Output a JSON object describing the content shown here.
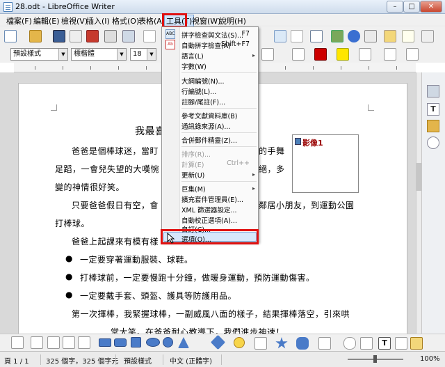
{
  "window": {
    "title": "28.odt - LibreOffice Writer",
    "min": "–",
    "max": "□",
    "close": "✕"
  },
  "menubar": {
    "items": [
      "檔案(F)",
      "編輯(E)",
      "檢視(V)",
      "插入(I)",
      "格式(O)",
      "表格(A)",
      "工具(T)",
      "視窗(W)",
      "說明(H)"
    ]
  },
  "format": {
    "style": "預設樣式",
    "font": "標楷體",
    "size": "18"
  },
  "document": {
    "title": "我最喜",
    "lines": [
      "爸爸是個棒球迷，當盯",
      "的手舞",
      "足蹈，一會兒失望的大嘆惋",
      "絕，多",
      "變的神情很好笑。",
      "只要爸爸假日有空，會",
      "鄰居小朋友，到運動公園",
      "打棒球。",
      "爸爸上起課來有模有樣",
      "一定要穿著運動服裝、球鞋。",
      "打棒球前，一定要慢跑十分鐘，做暖身運動，預防運動傷害。",
      "一定要戴手套、頭盔、護具等防護用品。",
      "第一次揮棒，我緊握球棒，一副威風八面的樣子，結果揮棒落空，引來哄",
      "堂大笑。在爸爸耐心教導下，我們進步神速！"
    ],
    "image_label": "影像1"
  },
  "tools_menu": {
    "items": [
      {
        "label": "拼字檢查與文法(S)...",
        "shortcut": "F7"
      },
      {
        "label": "自動拼字檢查(A)",
        "shortcut": "Shift+F7"
      },
      {
        "label": "語言(L)",
        "submenu": "▸"
      },
      {
        "label": "字數(W)"
      },
      {
        "label": "大綱編號(N)..."
      },
      {
        "label": "行編號(L)..."
      },
      {
        "label": "註腳/尾註(F)..."
      },
      {
        "label": "參考文獻資料庫(B)"
      },
      {
        "label": "通訊錄來源(A)..."
      },
      {
        "label": "合併郵件精靈(Z)..."
      },
      {
        "label": "排序(R)...",
        "disabled": true
      },
      {
        "label": "計算(E)",
        "shortcut": "Ctrl++",
        "disabled": true
      },
      {
        "label": "更新(U)",
        "submenu": "▸"
      },
      {
        "label": "巨集(M)",
        "submenu": "▸"
      },
      {
        "label": "擴充套件管理員(E)..."
      },
      {
        "label": "XML 篩選器設定..."
      },
      {
        "label": "自動校正選項(A)..."
      },
      {
        "label": "自訂(C)..."
      },
      {
        "label": "選項(O)..."
      }
    ]
  },
  "status": {
    "page": "頁 1 / 1",
    "words": "325 個字，325 個字元",
    "style": "預設樣式",
    "lang": "中文 (正體字)",
    "zoom": "100%"
  }
}
